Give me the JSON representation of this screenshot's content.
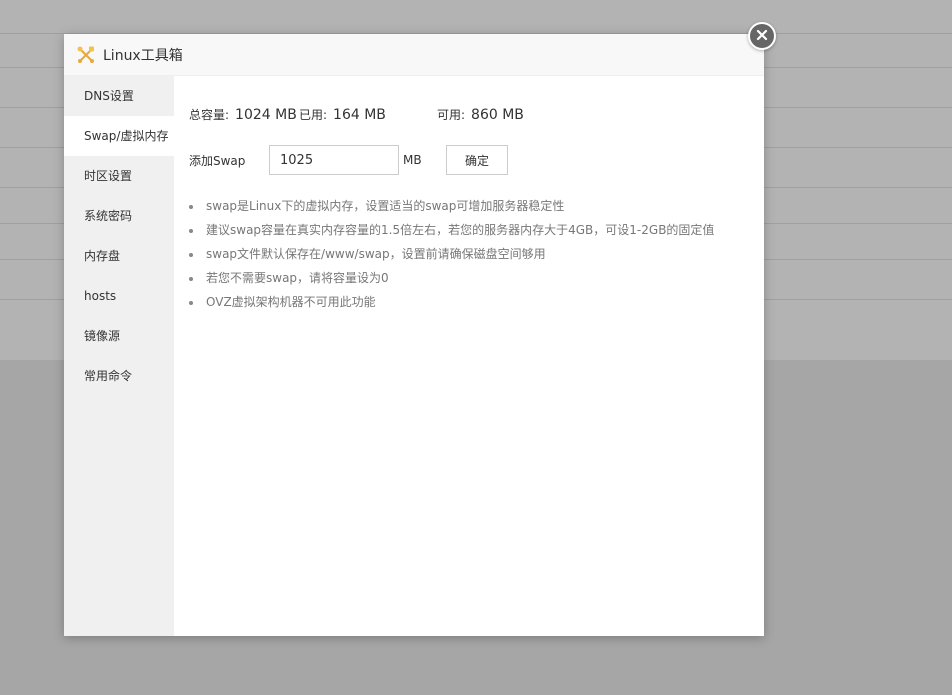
{
  "dialog": {
    "title": "Linux工具箱",
    "header_icon": "tools-icon",
    "close_icon": "close-icon"
  },
  "sidebar": {
    "items": [
      {
        "label": "DNS设置",
        "active": false
      },
      {
        "label": "Swap/虚拟内存",
        "active": true
      },
      {
        "label": "时区设置",
        "active": false
      },
      {
        "label": "系统密码",
        "active": false
      },
      {
        "label": "内存盘",
        "active": false
      },
      {
        "label": "hosts",
        "active": false
      },
      {
        "label": "镜像源",
        "active": false
      },
      {
        "label": "常用命令",
        "active": false
      }
    ]
  },
  "stats": {
    "total_label": "总容量:",
    "total_value": "1024 MB",
    "used_label": "已用:",
    "used_value": "164 MB",
    "free_label": "可用:",
    "free_value": "860 MB"
  },
  "swap": {
    "label": "添加Swap",
    "value": "1025",
    "unit": "MB",
    "confirm_label": "确定"
  },
  "tips": [
    "swap是Linux下的虚拟内存，设置适当的swap可增加服务器稳定性",
    "建议swap容量在真实内存容量的1.5倍左右，若您的服务器内存大于4GB，可设1-2GB的固定值",
    "swap文件默认保存在/www/swap，设置前请确保磁盘空间够用",
    "若您不需要swap，请将容量设为0",
    "OVZ虚拟架构机器不可用此功能"
  ]
}
